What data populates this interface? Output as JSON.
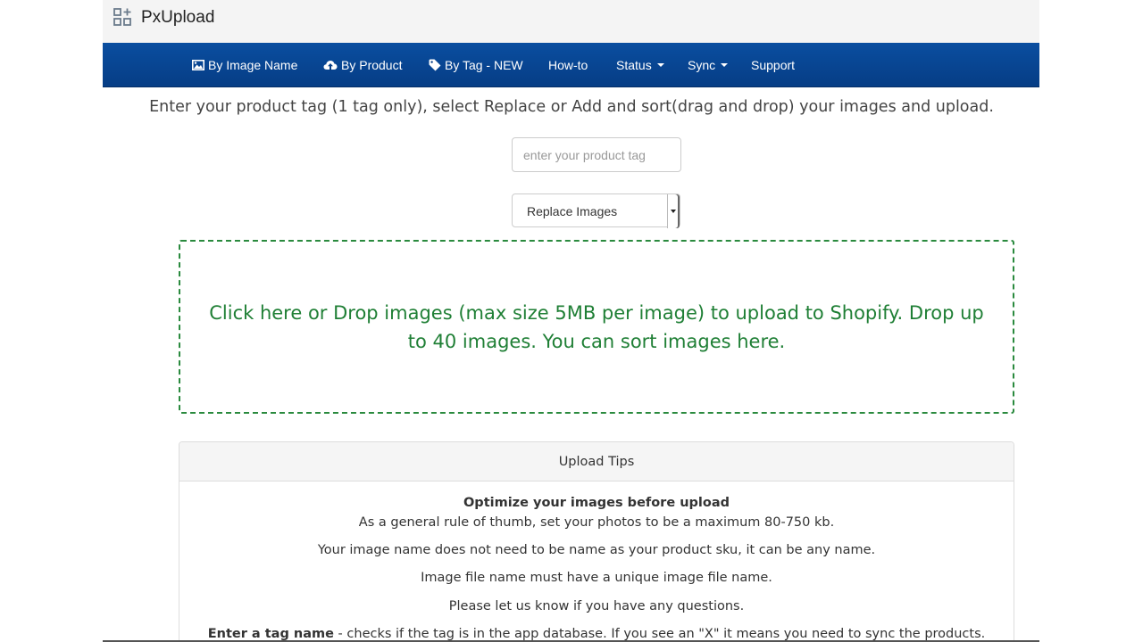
{
  "app": {
    "title": "PxUpload",
    "icon": "apps-add-icon"
  },
  "nav": {
    "items": [
      {
        "label": "By Image Name",
        "icon": "image-icon"
      },
      {
        "label": "By Product",
        "icon": "cloud-upload-icon"
      },
      {
        "label": "By Tag - NEW",
        "icon": "tag-icon"
      },
      {
        "label": "How-to"
      },
      {
        "label": "Status",
        "dropdown": true
      },
      {
        "label": "Sync",
        "dropdown": true
      },
      {
        "label": "Support"
      }
    ]
  },
  "form": {
    "instructions": "Enter your product tag (1 tag only), select Replace or Add and sort(drag and drop) your images and upload.",
    "tag_placeholder": "enter your product tag",
    "mode_selected": "Replace Images"
  },
  "dropzone": {
    "text": "Click here or Drop images (max size 5MB per image) to upload to Shopify. Drop up to 40 images. You can sort images here."
  },
  "tips": {
    "heading": "Upload Tips",
    "optimize_title": "Optimize your images before upload",
    "optimize_text": "As a general rule of thumb, set your photos to be a maximum 80-750 kb.",
    "name_text": "Your image name does not need to be name as your product sku, it can be any name.",
    "unique_text": "Image file name must have a unique image file name.",
    "questions_text": "Please let us know if you have any questions.",
    "tag_bold": "Enter a tag name",
    "tag_text": " - checks if the tag is in the app database. If you see an \"X\" it means you need to sync the products."
  },
  "colors": {
    "nav_bg": "#0a4ea0",
    "dropzone_green": "#1f7f35",
    "topbar_bg": "#f4f4f4"
  }
}
